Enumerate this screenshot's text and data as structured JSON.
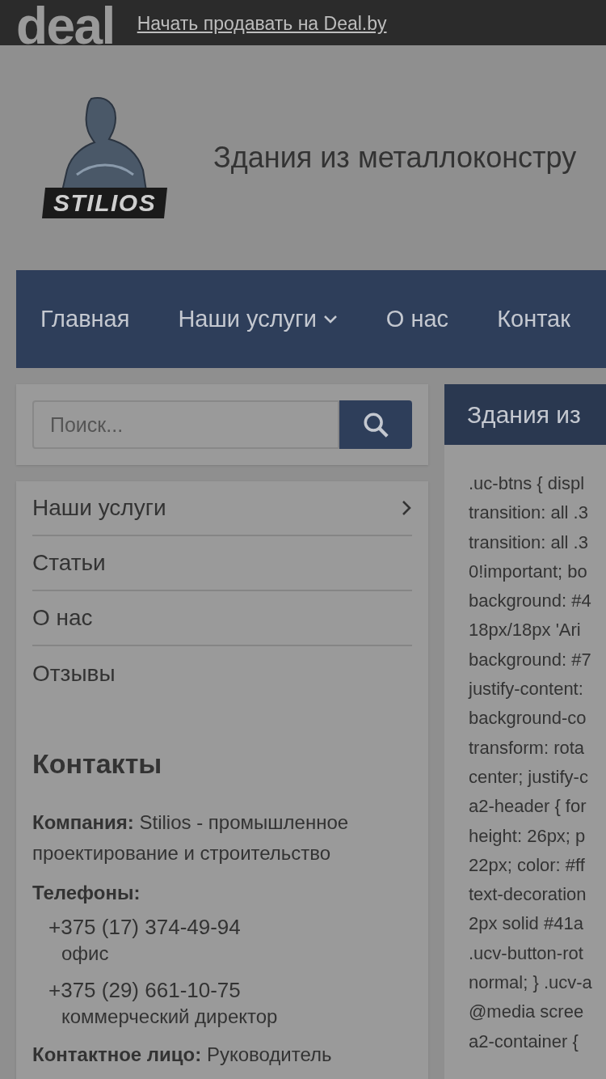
{
  "top_bar": {
    "logo": "deal",
    "link": "Начать продавать на Deal.by"
  },
  "header": {
    "logo_text": "STILIOS",
    "title": "Здания из металлоконстру"
  },
  "nav": [
    {
      "label": "Главная",
      "dropdown": false
    },
    {
      "label": "Наши услуги",
      "dropdown": true
    },
    {
      "label": "О нас",
      "dropdown": false
    },
    {
      "label": "Контак",
      "dropdown": false
    }
  ],
  "search": {
    "placeholder": "Поиск..."
  },
  "sidebar_menu": [
    {
      "label": "Наши услуги",
      "has_children": true
    },
    {
      "label": "Статьи",
      "has_children": false
    },
    {
      "label": "О нас",
      "has_children": false
    },
    {
      "label": "Отзывы",
      "has_children": false
    }
  ],
  "contacts": {
    "title": "Контакты",
    "company": "**Компания:** Stilios - промышленное проектирование и строительство",
    "phones_label": "Телефоны:",
    "phones": [
      {
        "number": "+375 (17) 374-49-94",
        "note": "офис"
      },
      {
        "number": "+375 (29) 661-10-75",
        "note": "коммерческий директор"
      }
    ],
    "contact_person": "**Контактное лицо:** Руководитель"
  },
  "content": {
    "title": "Здания из",
    "code_lines": [
      ".uc-btns { displ",
      "transition: all .3",
      "transition: all .3",
      "0!important; bo",
      "background: #4",
      "18px/18px 'Ari",
      "background: #7",
      "justify-content:",
      "background-co",
      "transform: rota",
      "center; justify-c",
      "a2-header { for",
      "height: 26px; p",
      "22px; color: #ff",
      "text-decoration",
      "2px solid #41a",
      ".ucv-button-rot",
      "normal; } .ucv-a",
      "@media scree",
      "a2-container { "
    ]
  }
}
